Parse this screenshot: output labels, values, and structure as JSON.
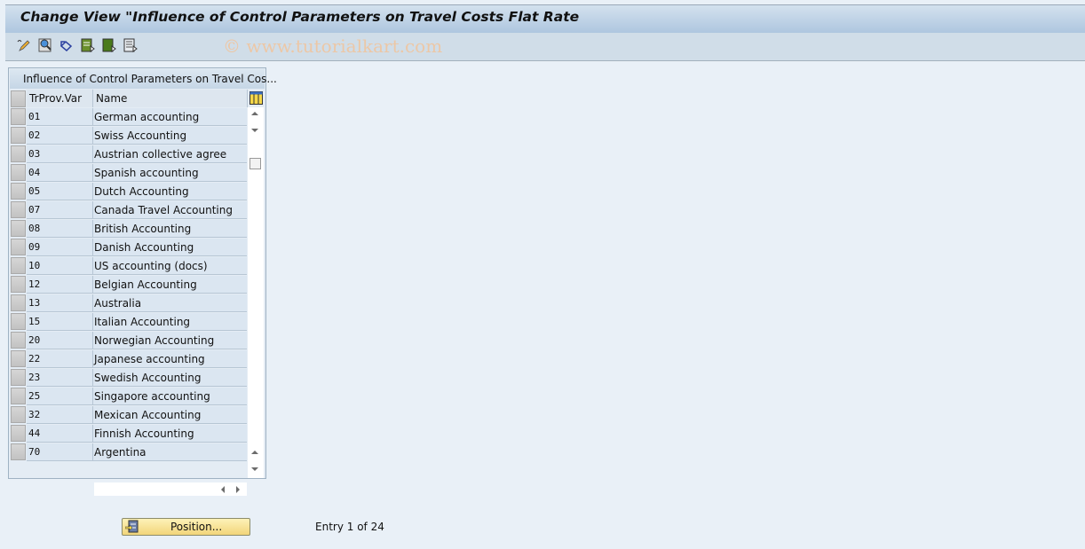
{
  "window": {
    "title": "Change View \"Influence of Control Parameters on Travel Costs Flat Rate"
  },
  "toolbar": {
    "icons": [
      "display-change-icon",
      "details-icon",
      "undo-icon",
      "select-all-icon",
      "select-block-icon",
      "deselect-all-icon"
    ],
    "watermark": "© www.tutorialkart.com"
  },
  "table": {
    "title": "Influence of Control Parameters on Travel Cos...",
    "columns": [
      "TrProv.Var",
      "Name"
    ],
    "rows": [
      {
        "code": "01",
        "name": "German accounting"
      },
      {
        "code": "02",
        "name": "Swiss Accounting"
      },
      {
        "code": "03",
        "name": "Austrian collective agree"
      },
      {
        "code": "04",
        "name": "Spanish accounting"
      },
      {
        "code": "05",
        "name": "Dutch Accounting"
      },
      {
        "code": "07",
        "name": "Canada Travel Accounting"
      },
      {
        "code": "08",
        "name": "British Accounting"
      },
      {
        "code": "09",
        "name": "Danish Accounting"
      },
      {
        "code": "10",
        "name": "US accounting (docs)"
      },
      {
        "code": "12",
        "name": "Belgian Accounting"
      },
      {
        "code": "13",
        "name": "Australia"
      },
      {
        "code": "15",
        "name": "Italian Accounting"
      },
      {
        "code": "20",
        "name": "Norwegian Accounting"
      },
      {
        "code": "22",
        "name": "Japanese accounting"
      },
      {
        "code": "23",
        "name": "Swedish Accounting"
      },
      {
        "code": "25",
        "name": "Singapore accounting"
      },
      {
        "code": "32",
        "name": "Mexican Accounting"
      },
      {
        "code": "44",
        "name": "Finnish Accounting"
      },
      {
        "code": "70",
        "name": "Argentina"
      }
    ]
  },
  "footer": {
    "position_button": "Position...",
    "entry_text": "Entry 1 of 24"
  }
}
